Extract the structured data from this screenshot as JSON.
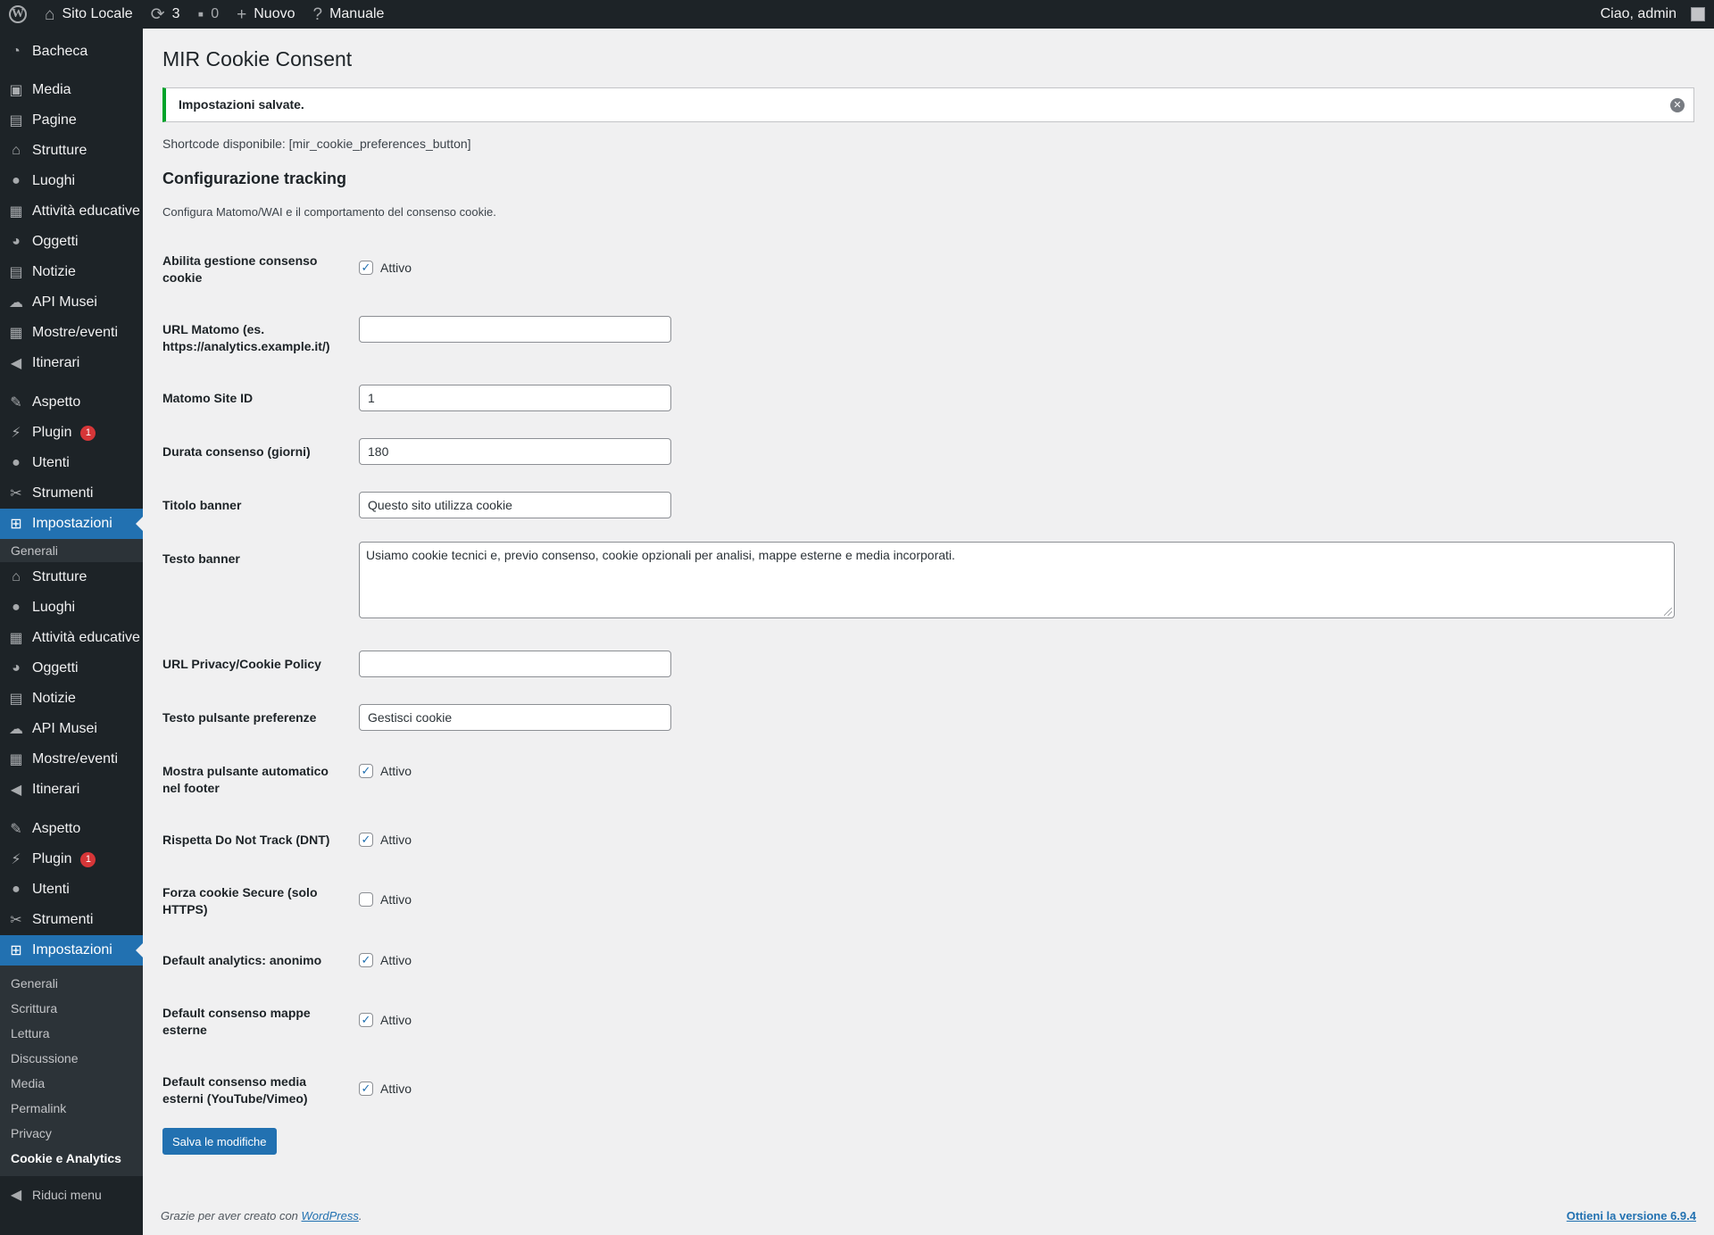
{
  "adminbar": {
    "site_name": "Sito Locale",
    "updates_count": "3",
    "comments_count": "0",
    "new_label": "Nuovo",
    "manual_label": "Manuale",
    "greeting": "Ciao, admin"
  },
  "sidebar": {
    "dashboard": "Bacheca",
    "group1": [
      {
        "label": "Media",
        "icon": "media-icon"
      },
      {
        "label": "Pagine",
        "icon": "pages-icon"
      },
      {
        "label": "Strutture",
        "icon": "building-icon"
      },
      {
        "label": "Luoghi",
        "icon": "location-pin-icon"
      },
      {
        "label": "Attività educative",
        "icon": "layout-icon"
      },
      {
        "label": "Oggetti",
        "icon": "pie-icon"
      },
      {
        "label": "Notizie",
        "icon": "document-icon"
      },
      {
        "label": "API Musei",
        "icon": "cloud-icon"
      },
      {
        "label": "Mostre/eventi",
        "icon": "calendar-icon"
      },
      {
        "label": "Itinerari",
        "icon": "megaphone-icon"
      }
    ],
    "appearance": "Aspetto",
    "plugins": "Plugin",
    "plugins_badge": "1",
    "users": "Utenti",
    "tools": "Strumenti",
    "settings": "Impostazioni",
    "settings_sub_single": "Generali",
    "group2": [
      {
        "label": "Strutture",
        "icon": "building-icon"
      },
      {
        "label": "Luoghi",
        "icon": "location-pin-icon"
      },
      {
        "label": "Attività educative",
        "icon": "layout-icon"
      },
      {
        "label": "Oggetti",
        "icon": "pie-icon"
      },
      {
        "label": "Notizie",
        "icon": "document-icon"
      },
      {
        "label": "API Musei",
        "icon": "cloud-icon"
      },
      {
        "label": "Mostre/eventi",
        "icon": "calendar-icon"
      },
      {
        "label": "Itinerari",
        "icon": "megaphone-icon"
      }
    ],
    "settings_submenu": [
      "Generali",
      "Scrittura",
      "Lettura",
      "Discussione",
      "Media",
      "Permalink",
      "Privacy",
      "Cookie e Analytics"
    ],
    "collapse": "Riduci menu"
  },
  "page": {
    "title": "MIR Cookie Consent",
    "notice": "Impostazioni salvate.",
    "shortcode": "Shortcode disponibile: [mir_cookie_preferences_button]",
    "section_title": "Configurazione tracking",
    "section_desc": "Configura Matomo/WAI e il comportamento del consenso cookie.",
    "active_label": "Attivo",
    "fields": {
      "enable": {
        "label": "Abilita gestione consenso cookie",
        "checked": true
      },
      "matomo_url": {
        "label": "URL Matomo (es. https://analytics.example.it/)",
        "value": ""
      },
      "site_id": {
        "label": "Matomo Site ID",
        "value": "1"
      },
      "duration": {
        "label": "Durata consenso (giorni)",
        "value": "180"
      },
      "banner_title": {
        "label": "Titolo banner",
        "value": "Questo sito utilizza cookie"
      },
      "banner_text": {
        "label": "Testo banner",
        "value": "Usiamo cookie tecnici e, previo consenso, cookie opzionali per analisi, mappe esterne e media incorporati."
      },
      "privacy_url": {
        "label": "URL Privacy/Cookie Policy",
        "value": ""
      },
      "pref_button": {
        "label": "Testo pulsante preferenze",
        "value": "Gestisci cookie"
      },
      "footer_button": {
        "label": "Mostra pulsante automatico nel footer",
        "checked": true
      },
      "dnt": {
        "label": "Rispetta Do Not Track (DNT)",
        "checked": true
      },
      "secure": {
        "label": "Forza cookie Secure (solo HTTPS)",
        "checked": false
      },
      "analytics_default": {
        "label": "Default analytics: anonimo",
        "checked": true
      },
      "maps_default": {
        "label": "Default consenso mappe esterne",
        "checked": true
      },
      "media_default": {
        "label": "Default consenso media esterni (YouTube/Vimeo)",
        "checked": true
      }
    },
    "save_button": "Salva le modifiche"
  },
  "footer": {
    "thanks_prefix": "Grazie per aver creato con ",
    "wp_link": "WordPress",
    "thanks_suffix": ".",
    "update_link": "Ottieni la versione 6.9.4"
  },
  "colors": {
    "admin_dark": "#1d2327",
    "accent": "#2271b1",
    "success": "#00a32a",
    "badge": "#d63638"
  }
}
